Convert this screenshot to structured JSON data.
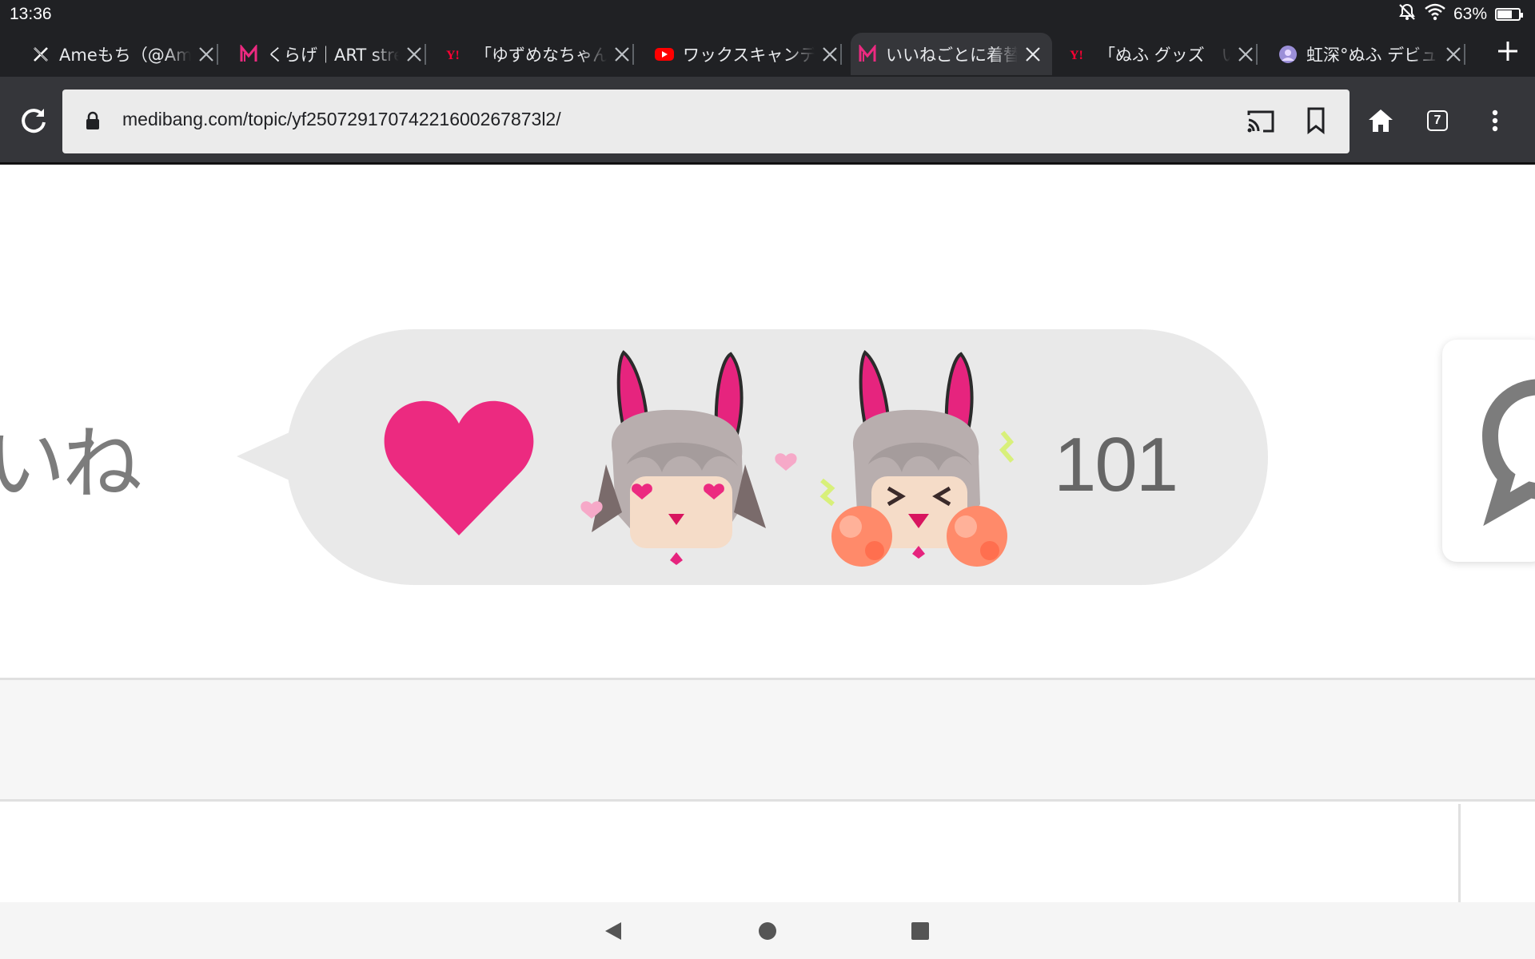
{
  "status_bar": {
    "time": "13:36",
    "battery": "63%",
    "battery_level": 0.63,
    "icons": [
      "bell-off-icon",
      "wifi-icon",
      "battery-icon"
    ]
  },
  "tabs": [
    {
      "title": "Ameもち（@Ameもち",
      "favicon": "x-icon",
      "active": false
    },
    {
      "title": "くらげ｜ART street",
      "favicon": "medibang-icon",
      "active": false
    },
    {
      "title": "「ゆずめなちゃん",
      "favicon": "yahoo-icon",
      "active": false
    },
    {
      "title": "ワックスキャンディ",
      "favicon": "youtube-icon",
      "active": false
    },
    {
      "title": "いいねごとに着替え",
      "favicon": "medibang-icon",
      "active": true
    },
    {
      "title": "「ぬふ グッズ　い",
      "favicon": "yahoo-icon",
      "active": false
    },
    {
      "title": "虹深°ぬふ デビュー",
      "favicon": "avatar-icon",
      "active": false
    }
  ],
  "toolbar": {
    "url": "medibang.com/topic/yf25072917074221600267873l2/",
    "tab_count": "7"
  },
  "page": {
    "side_text": "いね",
    "like_count": "101"
  },
  "colors": {
    "heart": "#ec2a80",
    "chrome_dark": "#202124",
    "toolbar": "#35363a",
    "omnibox": "#ebebeb",
    "bubble": "#e9e9e9"
  }
}
